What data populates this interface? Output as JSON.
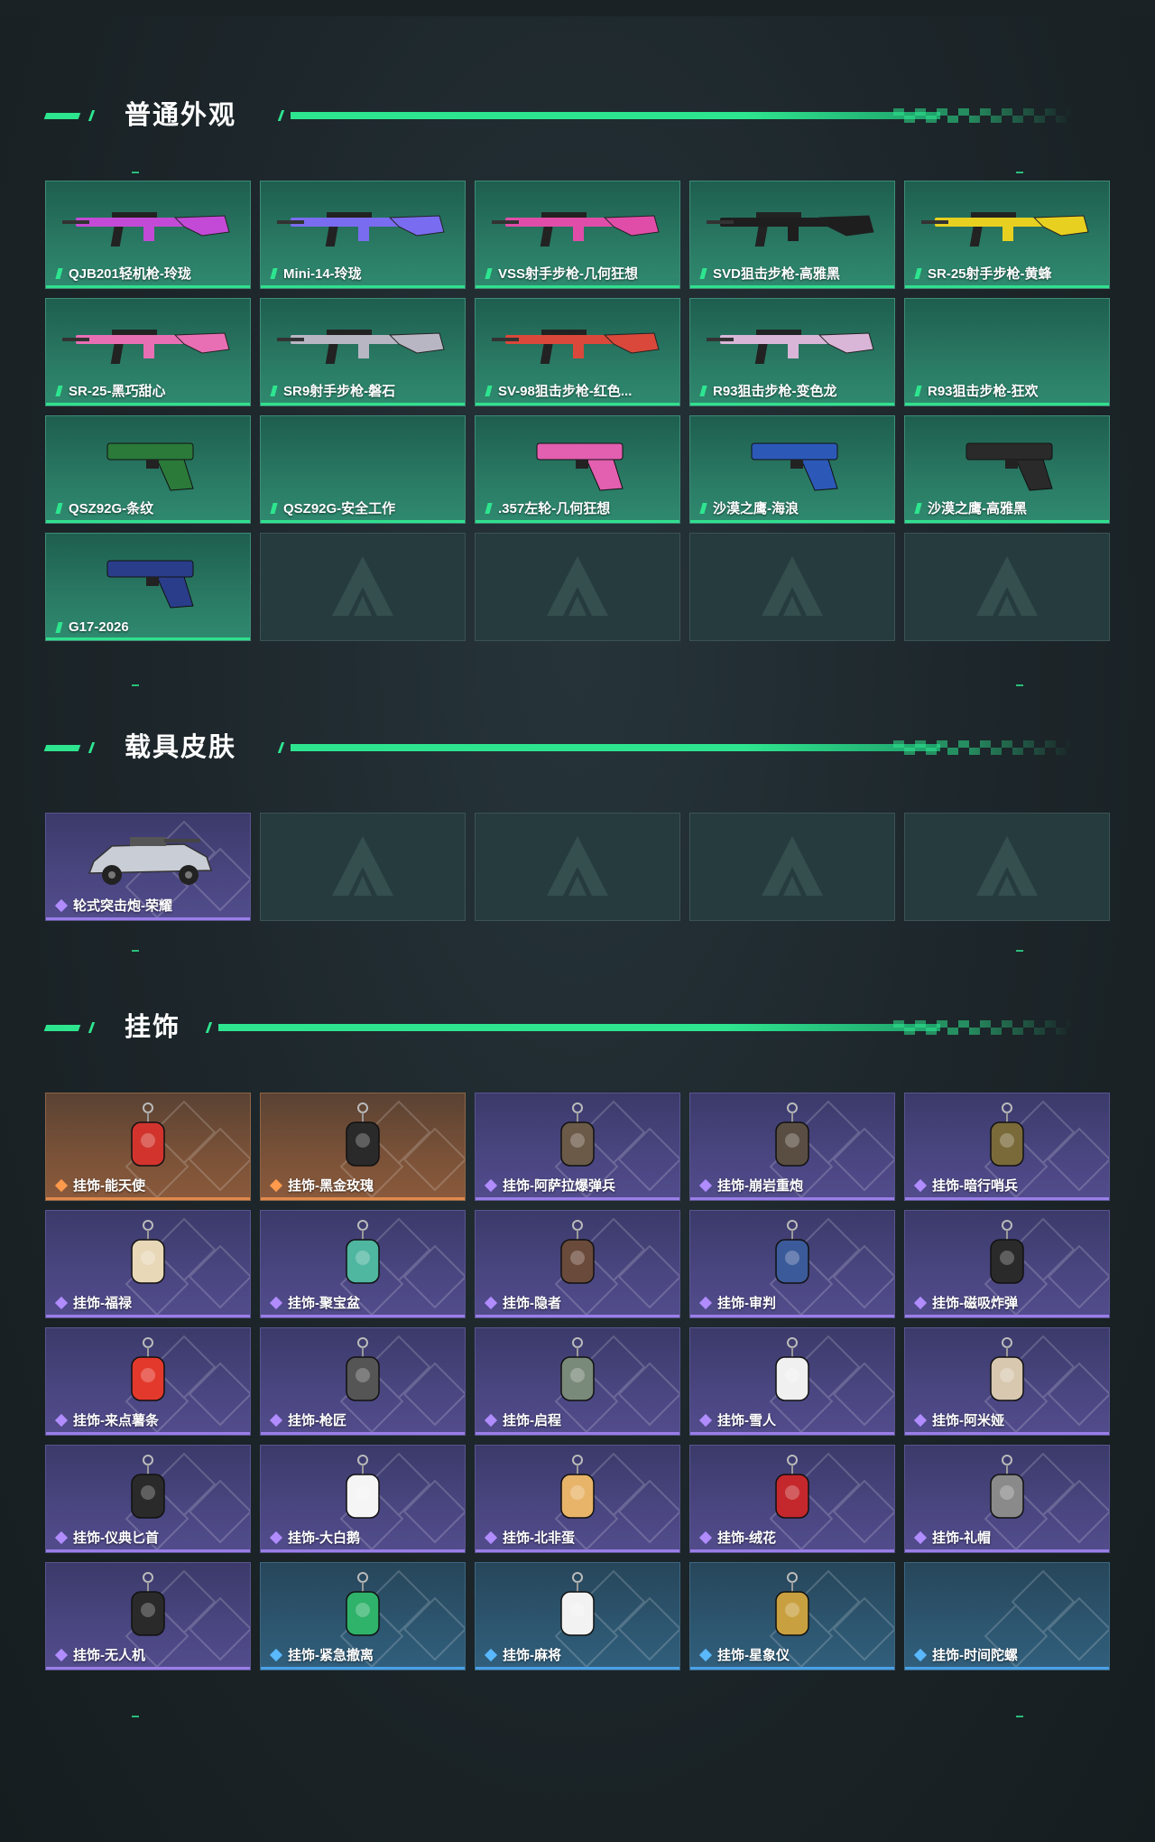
{
  "sections": [
    {
      "title": "普通外观",
      "items": [
        {
          "label": "QJB201轻机枪-玲珑",
          "rarity": "green",
          "icon": "gun-light-machine-gun-icon",
          "color": "#c34ad6"
        },
        {
          "label": "Mini-14-玲珑",
          "rarity": "green",
          "icon": "gun-rifle-icon",
          "color": "#7a6cf0"
        },
        {
          "label": "VSS射手步枪-几何狂想",
          "rarity": "green",
          "icon": "gun-marksman-rifle-icon",
          "color": "#e04da8"
        },
        {
          "label": "SVD狙击步枪-高雅黑",
          "rarity": "green",
          "icon": "gun-sniper-rifle-icon",
          "color": "#1e1e1e"
        },
        {
          "label": "SR-25射手步枪-黄蜂",
          "rarity": "green",
          "icon": "gun-marksman-rifle-icon",
          "color": "#e7d020"
        },
        {
          "label": "SR-25-黑巧甜心",
          "rarity": "green",
          "icon": "gun-marksman-rifle-icon",
          "color": "#e86fb4"
        },
        {
          "label": "SR9射手步枪-磐石",
          "rarity": "green",
          "icon": "gun-marksman-rifle-icon",
          "color": "#b9b6c4"
        },
        {
          "label": "SV-98狙击步枪-红色...",
          "rarity": "green",
          "icon": "gun-sniper-rifle-icon",
          "color": "#d9483a"
        },
        {
          "label": "R93狙击步枪-变色龙",
          "rarity": "green",
          "icon": "gun-sniper-rifle-icon",
          "color": "#d9b6d8"
        },
        {
          "label": "R93狙击步枪-狂欢",
          "rarity": "green",
          "icon": "",
          "color": ""
        },
        {
          "label": "QSZ92G-条纹",
          "rarity": "green",
          "icon": "pistol-icon",
          "color": "#2b7a3a"
        },
        {
          "label": "QSZ92G-安全工作",
          "rarity": "green",
          "icon": "",
          "color": ""
        },
        {
          "label": ".357左轮-几何狂想",
          "rarity": "green",
          "icon": "revolver-icon",
          "color": "#e35fb0"
        },
        {
          "label": "沙漠之鹰-海浪",
          "rarity": "green",
          "icon": "pistol-icon",
          "color": "#2c59b8"
        },
        {
          "label": "沙漠之鹰-高雅黑",
          "rarity": "green",
          "icon": "pistol-icon",
          "color": "#2a2a2a"
        },
        {
          "label": "G17-2026",
          "rarity": "green",
          "icon": "pistol-icon",
          "color": "#2a3d8a"
        }
      ],
      "empty_slots": 4
    },
    {
      "title": "载具皮肤",
      "items": [
        {
          "label": "轮式突击炮-荣耀",
          "rarity": "purple",
          "icon": "vehicle-assault-car-icon",
          "color": "#c9cdd6"
        }
      ],
      "empty_slots": 4
    },
    {
      "title": "挂饰",
      "items": [
        {
          "label": "挂饰-能天使",
          "rarity": "orange",
          "icon": "charm-card-icon",
          "color": "#d2342d"
        },
        {
          "label": "挂饰-黑金玫瑰",
          "rarity": "orange",
          "icon": "charm-rose-icon",
          "color": "#2a2a2a"
        },
        {
          "label": "挂饰-阿萨拉爆弹兵",
          "rarity": "purple",
          "icon": "charm-soldier-icon",
          "color": "#6b5a48"
        },
        {
          "label": "挂饰-崩岩重炮",
          "rarity": "purple",
          "icon": "charm-soldier-icon",
          "color": "#5a4e42"
        },
        {
          "label": "挂饰-暗行哨兵",
          "rarity": "purple",
          "icon": "charm-soldier-icon",
          "color": "#7a6a3a"
        },
        {
          "label": "挂饰-福禄",
          "rarity": "purple",
          "icon": "charm-gourd-icon",
          "color": "#e8d8b8"
        },
        {
          "label": "挂饰-聚宝盆",
          "rarity": "purple",
          "icon": "charm-treasure-bowl-icon",
          "color": "#4fb6a0"
        },
        {
          "label": "挂饰-隐者",
          "rarity": "purple",
          "icon": "charm-card-icon",
          "color": "#6a4a3a"
        },
        {
          "label": "挂饰-审判",
          "rarity": "purple",
          "icon": "charm-card-icon",
          "color": "#3b5a9a"
        },
        {
          "label": "挂饰-磁吸炸弹",
          "rarity": "purple",
          "icon": "charm-bomb-icon",
          "color": "#2a2a2a"
        },
        {
          "label": "挂饰-来点薯条",
          "rarity": "purple",
          "icon": "charm-fries-icon",
          "color": "#e3392c"
        },
        {
          "label": "挂饰-枪匠",
          "rarity": "purple",
          "icon": "charm-patch-icon",
          "color": "#555555"
        },
        {
          "label": "挂饰-启程",
          "rarity": "purple",
          "icon": "charm-medal-icon",
          "color": "#7a8a7a"
        },
        {
          "label": "挂饰-雪人",
          "rarity": "purple",
          "icon": "charm-snowman-icon",
          "color": "#f0f0f0"
        },
        {
          "label": "挂饰-阿米娅",
          "rarity": "purple",
          "icon": "charm-bunny-icon",
          "color": "#d8c8b0"
        },
        {
          "label": "挂饰-仪典匕首",
          "rarity": "purple",
          "icon": "charm-dagger-icon",
          "color": "#2a2a2a"
        },
        {
          "label": "挂饰-大白鹅",
          "rarity": "purple",
          "icon": "charm-goose-icon",
          "color": "#f5f5f5"
        },
        {
          "label": "挂饰-北非蛋",
          "rarity": "purple",
          "icon": "charm-egg-icon",
          "color": "#e8b46a"
        },
        {
          "label": "挂饰-绒花",
          "rarity": "purple",
          "icon": "charm-flower-icon",
          "color": "#c4282c"
        },
        {
          "label": "挂饰-礼帽",
          "rarity": "purple",
          "icon": "charm-hat-icon",
          "color": "#8a8a8a"
        },
        {
          "label": "挂饰-无人机",
          "rarity": "purple",
          "icon": "charm-drone-icon",
          "color": "#2a2a2a"
        },
        {
          "label": "挂饰-紧急撤离",
          "rarity": "blue",
          "icon": "charm-sign-icon",
          "color": "#2fb26a"
        },
        {
          "label": "挂饰-麻将",
          "rarity": "blue",
          "icon": "charm-mahjong-icon",
          "color": "#f2f2f2"
        },
        {
          "label": "挂饰-星象仪",
          "rarity": "blue",
          "icon": "charm-astrolabe-icon",
          "color": "#c8a040"
        },
        {
          "label": "挂饰-时间陀螺",
          "rarity": "blue",
          "icon": "",
          "color": ""
        }
      ],
      "empty_slots": 0
    }
  ],
  "colors": {
    "accent": "#2ee58f",
    "green_card": "#2a7a64",
    "purple_card": "#4a4681",
    "orange_card": "#7b5238",
    "blue_card": "#2d5670",
    "empty_card": "#263b3d"
  }
}
